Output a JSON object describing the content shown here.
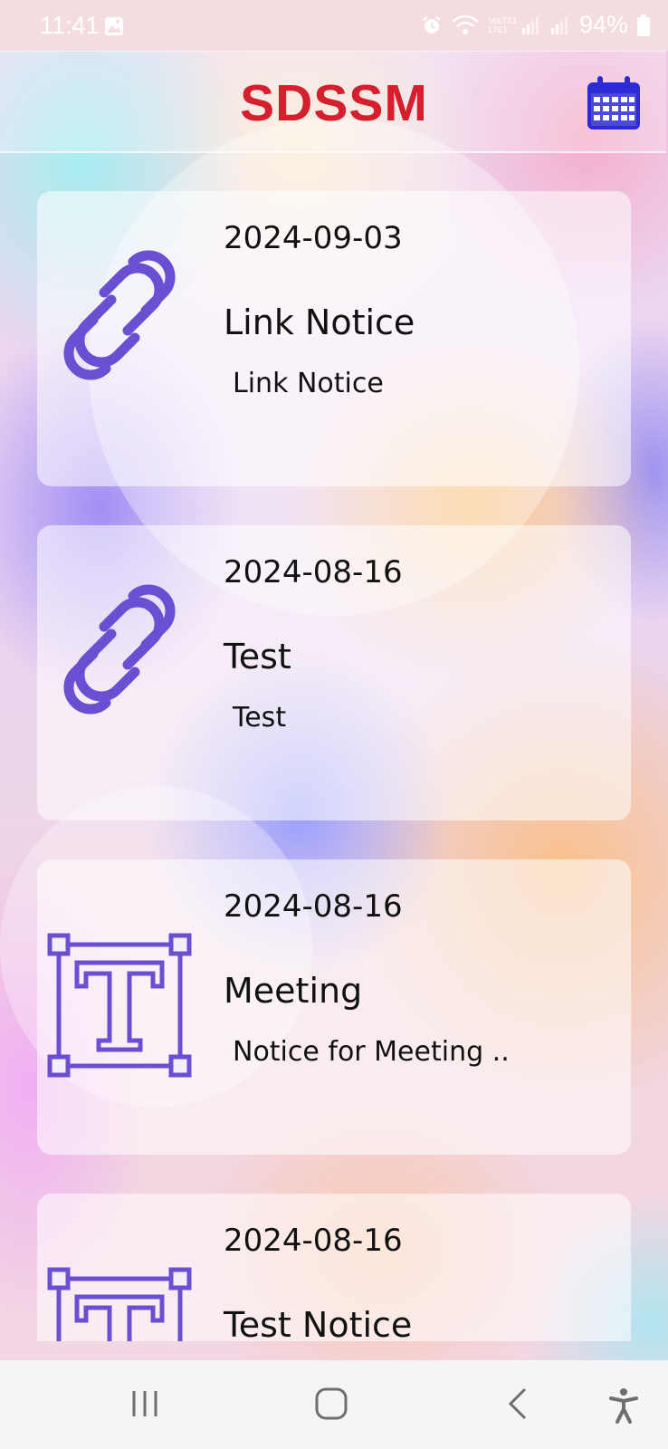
{
  "status_bar": {
    "time": "11:41",
    "battery": "94%",
    "network": "VoLTE1 LTE1"
  },
  "header": {
    "title": "SDSSM",
    "title_color": "#d61f2c",
    "calendar_icon": "calendar-icon",
    "icon_color": "#2d2bd4"
  },
  "notices": [
    {
      "date": "2024-09-03",
      "title": "Link Notice",
      "description": "Link Notice",
      "icon": "link-icon"
    },
    {
      "date": "2024-08-16",
      "title": "Test",
      "description": "Test",
      "icon": "link-icon"
    },
    {
      "date": "2024-08-16",
      "title": "Meeting",
      "description": "Notice for Meeting ..",
      "icon": "text-icon"
    },
    {
      "date": "2024-08-16",
      "title": "Test Notice",
      "description": "",
      "icon": "text-icon"
    }
  ],
  "icon_color": "#6a4fd3",
  "nav_bar": {
    "items": [
      "recent-apps-icon",
      "home-icon",
      "back-icon",
      "accessibility-icon"
    ]
  }
}
